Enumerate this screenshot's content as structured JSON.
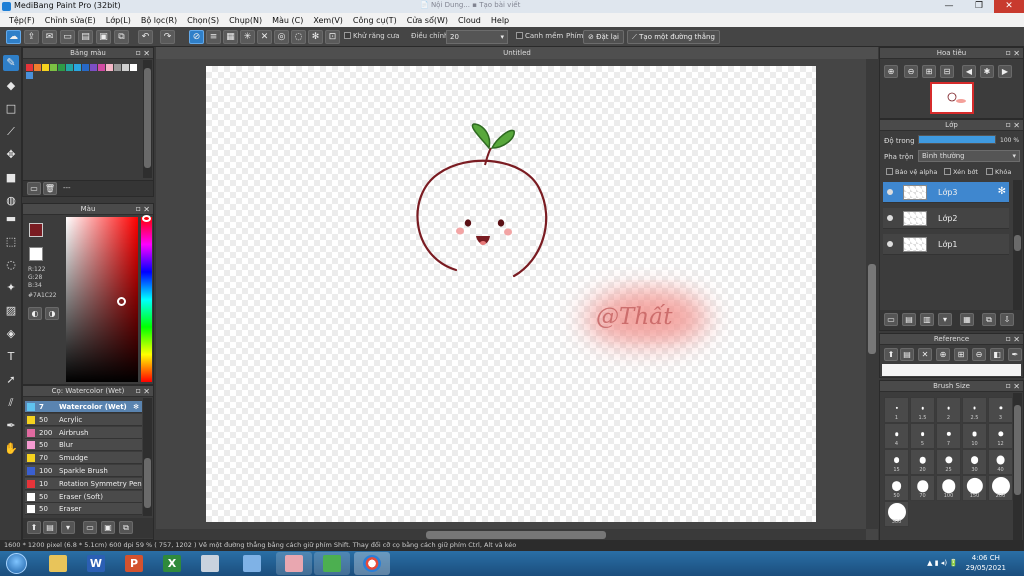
{
  "window": {
    "title": "MediBang Paint Pro (32bit)",
    "background_tabs": "📄 Nội Dung... ▪ Tạo bài viết"
  },
  "menu": [
    "Tệp(F)",
    "Chỉnh sửa(E)",
    "Lớp(L)",
    "Bộ lọc(R)",
    "Chọn(S)",
    "Chụp(N)",
    "Màu (C)",
    "Xem(V)",
    "Công cụ(T)",
    "Cửa sổ(W)",
    "Cloud",
    "Help"
  ],
  "toolbar": {
    "antialias_label": "Khử răng cưa",
    "correction_label": "Điều chỉnh",
    "correction_value": "20",
    "snap_label": "Canh mềm",
    "key_label": "Phím",
    "reset_label": "Đặt lại",
    "create_line_label": "Tạo một đường thẳng"
  },
  "palette_panel": {
    "title": "Bảng màu",
    "swatches": [
      "#e6343a",
      "#f07f2e",
      "#f5d21f",
      "#7cc043",
      "#2e9b47",
      "#23a7a4",
      "#2aa6e0",
      "#2869c7",
      "#7b4fc4",
      "#d24ba3",
      "#f5b8c8",
      "#9a9a9a",
      "#cfcfcf",
      "#ffffff",
      "#4a90d9"
    ],
    "empty_text": "---"
  },
  "color_panel": {
    "title": "Màu",
    "main_color": "#7A1C22",
    "r": "R:122",
    "g": "G:28",
    "b": "B:34",
    "hex": "#7A1C22"
  },
  "brush_panel": {
    "title": "Cọ: Watercolor (Wet)",
    "brushes": [
      {
        "size": "7",
        "name": "Watercolor (Wet)",
        "color": "#5fc3f0"
      },
      {
        "size": "50",
        "name": "Acrylic",
        "color": "#f5d21f"
      },
      {
        "size": "200",
        "name": "Airbrush",
        "color": "#e06aa0"
      },
      {
        "size": "50",
        "name": "Blur",
        "color": "#f49ad0"
      },
      {
        "size": "70",
        "name": "Smudge",
        "color": "#f5d21f"
      },
      {
        "size": "100",
        "name": "Sparkle Brush",
        "color": "#3a5fd0"
      },
      {
        "size": "10",
        "name": "Rotation Symmetry Pen",
        "color": "#e6343a"
      },
      {
        "size": "50",
        "name": "Eraser (Soft)",
        "color": "#ffffff"
      },
      {
        "size": "50",
        "name": "Eraser",
        "color": "#ffffff"
      }
    ]
  },
  "canvas": {
    "doc_title": "Untitled",
    "watermark": "@Thất",
    "bg_color": "#ffffff",
    "line_color": "#7a1c22"
  },
  "navigator": {
    "title": "Hoa tiêu"
  },
  "layers": {
    "title": "Lớp",
    "opacity_label": "Độ trong",
    "opacity_value": "100 %",
    "opacity_fraction": 1.0,
    "blend_label": "Pha trộn",
    "blend_value": "Bình thường",
    "protect_alpha": "Bảo vệ alpha",
    "clipping": "Xén bớt",
    "lock": "Khóa",
    "items": [
      {
        "name": "Lớp3",
        "selected": true
      },
      {
        "name": "Lớp2",
        "selected": false
      },
      {
        "name": "Lớp1",
        "selected": false
      }
    ]
  },
  "reference": {
    "title": "Reference"
  },
  "brush_size": {
    "title": "Brush Size",
    "sizes": [
      "1",
      "1.5",
      "2",
      "2.5",
      "3",
      "4",
      "5",
      "7",
      "10",
      "12",
      "15",
      "20",
      "25",
      "30",
      "40",
      "50",
      "70",
      "100",
      "150",
      "200",
      "300"
    ]
  },
  "status": {
    "text": "1600 * 1200 pixel   (6.8 * 5.1cm)   600 dpi   59 %   ( 757, 1202 )   Vẽ một đường thẳng bằng cách giữ phím Shift. Thay đổi cỡ cọ bằng cách giữ phím Ctrl, Alt và kéo"
  },
  "taskbar": {
    "time": "4:06 CH",
    "date": "29/05/2021",
    "tray": "▲ ▮ ◂) 🔋"
  }
}
